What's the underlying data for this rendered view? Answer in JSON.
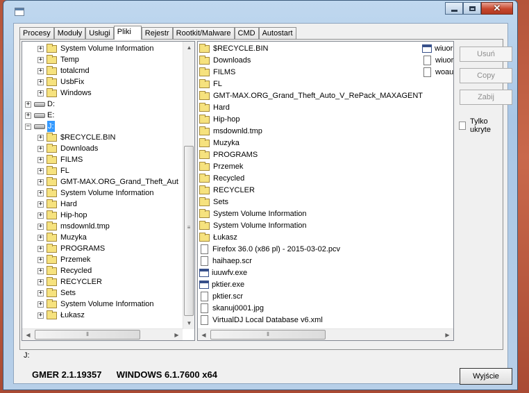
{
  "window": {
    "minimize_label": "–",
    "maximize_label": "□",
    "close_label": "✕"
  },
  "tabs": [
    {
      "label": "Procesy"
    },
    {
      "label": "Moduły"
    },
    {
      "label": "Usługi"
    },
    {
      "label": "Pliki"
    },
    {
      "label": "Rejestr"
    },
    {
      "label": "Rootkit/Malware"
    },
    {
      "label": "CMD"
    },
    {
      "label": "Autostart"
    }
  ],
  "active_tab": "Pliki",
  "tree": {
    "items": [
      {
        "label": "System Volume Information",
        "type": "folder"
      },
      {
        "label": "Temp",
        "type": "folder"
      },
      {
        "label": "totalcmd",
        "type": "folder"
      },
      {
        "label": "UsbFix",
        "type": "folder"
      },
      {
        "label": "Windows",
        "type": "folder"
      },
      {
        "label": "D:",
        "type": "drive"
      },
      {
        "label": "E:",
        "type": "drive"
      },
      {
        "label": "J:",
        "type": "drive",
        "selected": true
      },
      {
        "label": "$RECYCLE.BIN",
        "type": "folder"
      },
      {
        "label": "Downloads",
        "type": "folder"
      },
      {
        "label": "FILMS",
        "type": "folder"
      },
      {
        "label": "FL",
        "type": "folder"
      },
      {
        "label": "GMT-MAX.ORG_Grand_Theft_Aut",
        "type": "folder"
      },
      {
        "label": "System Volume Information",
        "type": "folder"
      },
      {
        "label": "Hard",
        "type": "folder"
      },
      {
        "label": "Hip-hop",
        "type": "folder"
      },
      {
        "label": "msdownld.tmp",
        "type": "folder"
      },
      {
        "label": "Muzyka",
        "type": "folder"
      },
      {
        "label": "PROGRAMS",
        "type": "folder"
      },
      {
        "label": "Przemek",
        "type": "folder"
      },
      {
        "label": "Recycled",
        "type": "folder"
      },
      {
        "label": "RECYCLER",
        "type": "folder"
      },
      {
        "label": "Sets",
        "type": "folder"
      },
      {
        "label": "System Volume Information",
        "type": "folder"
      },
      {
        "label": "Łukasz",
        "type": "folder"
      }
    ]
  },
  "files": {
    "column1": [
      {
        "label": "$RECYCLE.BIN",
        "type": "folder"
      },
      {
        "label": "Downloads",
        "type": "folder"
      },
      {
        "label": "FILMS",
        "type": "folder"
      },
      {
        "label": "FL",
        "type": "folder"
      },
      {
        "label": "GMT-MAX.ORG_Grand_Theft_Auto_V_RePack_MAXAGENT",
        "type": "folder"
      },
      {
        "label": "Hard",
        "type": "folder"
      },
      {
        "label": "Hip-hop",
        "type": "folder"
      },
      {
        "label": "msdownld.tmp",
        "type": "folder"
      },
      {
        "label": "Muzyka",
        "type": "folder"
      },
      {
        "label": "PROGRAMS",
        "type": "folder"
      },
      {
        "label": "Przemek",
        "type": "folder"
      },
      {
        "label": "Recycled",
        "type": "folder"
      },
      {
        "label": "RECYCLER",
        "type": "folder"
      },
      {
        "label": "Sets",
        "type": "folder"
      },
      {
        "label": "System Volume Information",
        "type": "folder"
      },
      {
        "label": "System Volume Information",
        "type": "folder"
      },
      {
        "label": "Łukasz",
        "type": "folder"
      },
      {
        "label": "Firefox 36.0 (x86 pl) - 2015-03-02.pcv",
        "type": "file"
      },
      {
        "label": "haihaep.scr",
        "type": "file"
      },
      {
        "label": "iuuwfv.exe",
        "type": "exe"
      },
      {
        "label": "pktier.exe",
        "type": "exe"
      },
      {
        "label": "pktier.scr",
        "type": "file"
      },
      {
        "label": "skanuj0001.jpg",
        "type": "file"
      },
      {
        "label": "VirtualDJ Local Database v6.xml",
        "type": "file"
      }
    ],
    "column2": [
      {
        "label": "wiuoru",
        "type": "exe"
      },
      {
        "label": "wiuoru",
        "type": "file"
      },
      {
        "label": "woaur",
        "type": "file"
      }
    ]
  },
  "buttons": {
    "remove": "Usuń",
    "copy": "Copy",
    "kill": "Zabij"
  },
  "checkbox": {
    "label": "Tylko ukryte",
    "checked": false
  },
  "status_path": "J:",
  "footer": {
    "version": "GMER 2.1.19357",
    "os": "WINDOWS 6.1.7600  x64"
  },
  "exit_button": "Wyjście",
  "scroll_grip": "≡"
}
